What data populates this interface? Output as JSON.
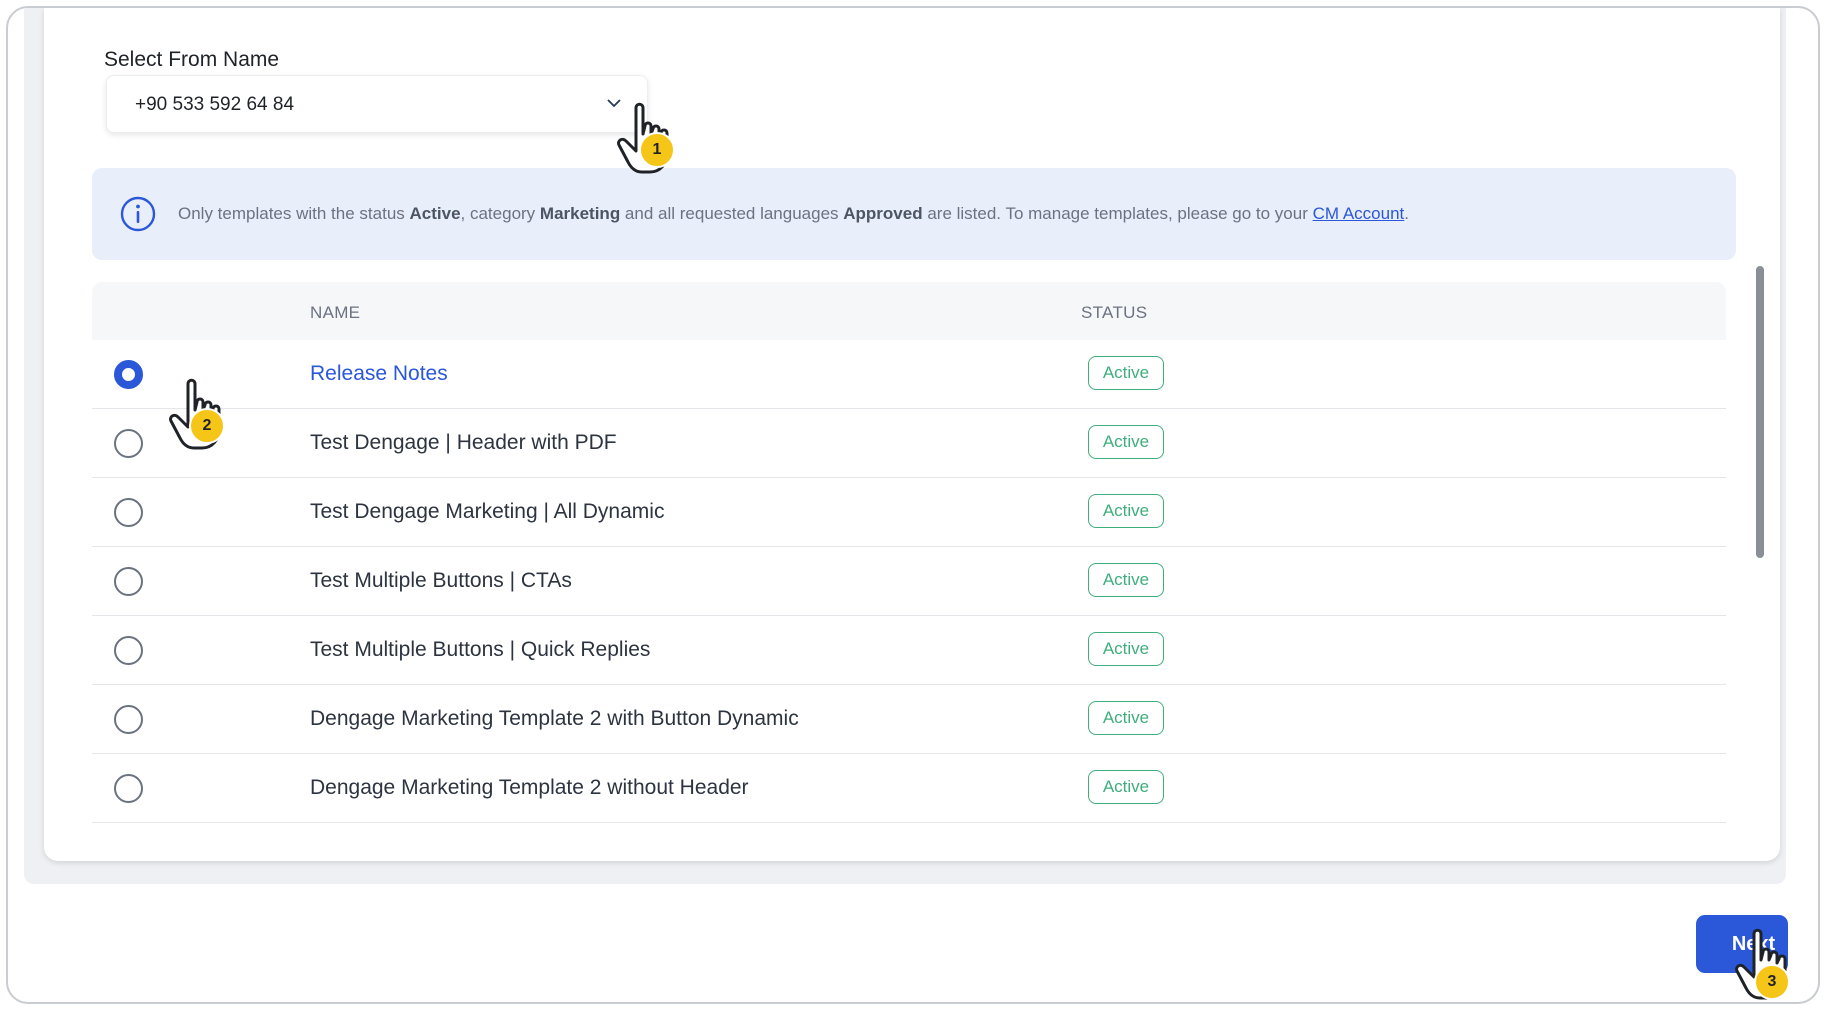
{
  "from_name": {
    "label": "Select From Name",
    "selected_value": "+90 533 592 64 84"
  },
  "info_banner": {
    "text_1": "Only templates with the status ",
    "bold_1": "Active",
    "text_2": ", category ",
    "bold_2": "Marketing",
    "text_3": " and all requested languages ",
    "bold_3": "Approved",
    "text_4": " are listed. To manage templates, please go to your ",
    "link": "CM Account",
    "text_5": "."
  },
  "table": {
    "headers": {
      "name": "NAME",
      "status": "STATUS"
    },
    "rows": [
      {
        "name": "Release Notes",
        "status": "Active",
        "selected": true
      },
      {
        "name": "Test Dengage | Header with PDF",
        "status": "Active",
        "selected": false
      },
      {
        "name": "Test Dengage Marketing | All Dynamic",
        "status": "Active",
        "selected": false
      },
      {
        "name": "Test Multiple Buttons | CTAs",
        "status": "Active",
        "selected": false
      },
      {
        "name": "Test Multiple Buttons | Quick Replies",
        "status": "Active",
        "selected": false
      },
      {
        "name": "Dengage Marketing Template 2 with Button Dynamic",
        "status": "Active",
        "selected": false
      },
      {
        "name": "Dengage Marketing Template 2 without Header",
        "status": "Active",
        "selected": false
      }
    ]
  },
  "footer": {
    "next_label": "Next"
  },
  "steps": {
    "one": "1",
    "two": "2",
    "three": "3"
  },
  "colors": {
    "accent": "#2b57d9",
    "status_green": "#3eae7d",
    "step_yellow": "#f5c518",
    "banner_bg": "#e9eefb"
  }
}
